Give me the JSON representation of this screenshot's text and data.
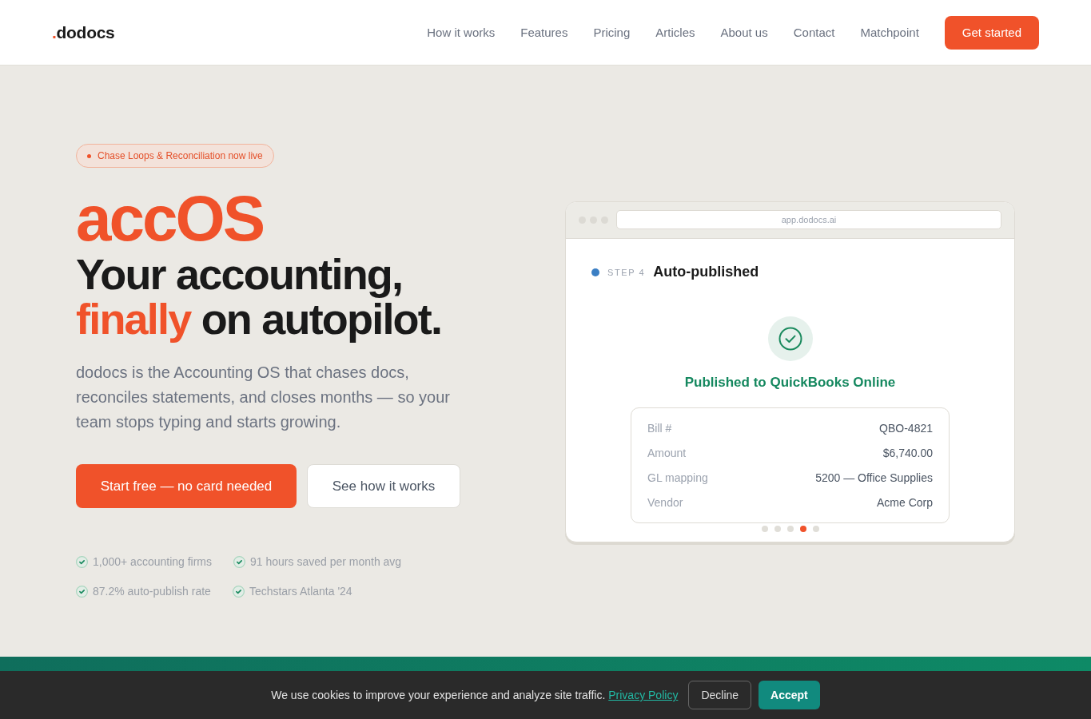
{
  "header": {
    "logo": {
      "dot": ".",
      "name": "dodocs"
    },
    "nav": [
      "How it works",
      "Features",
      "Pricing",
      "Articles",
      "About us",
      "Contact",
      "Matchpoint"
    ],
    "cta": "Get started"
  },
  "hero": {
    "badge": "Chase Loops & Reconciliation now live",
    "brand": "accOS",
    "headline": {
      "start": "Your accounting,",
      "accent": "finally",
      "end": "on autopilot."
    },
    "subtitle": "dodocs is the Accounting OS that chases docs, reconciles statements, and closes months — so your team stops typing and starts growing.",
    "buttons": [
      {
        "label": "Start free — no card needed",
        "kind": "primary"
      },
      {
        "label": "See how it works",
        "kind": "secondary"
      }
    ],
    "stats": [
      "1,000+ accounting firms",
      "91 hours saved per month avg",
      "87.2% auto-publish rate",
      "Techstars Atlanta '24"
    ]
  },
  "mockup": {
    "address": "app.dodocs.ai",
    "step_label": "STEP 4",
    "step_title": "Auto-published",
    "status": "Published to QuickBooks Online",
    "details": [
      {
        "label": "Bill #",
        "value": "QBO-4821"
      },
      {
        "label": "Amount",
        "value": "$6,740.00"
      },
      {
        "label": "GL mapping",
        "value": "5200 — Office Supplies"
      },
      {
        "label": "Vendor",
        "value": "Acme Corp"
      }
    ],
    "slides": [
      {
        "selected": false
      },
      {
        "selected": false
      },
      {
        "selected": false
      },
      {
        "selected": true
      },
      {
        "selected": false
      }
    ]
  },
  "cookie_banner": {
    "text": "We use cookies to improve your experience and analyze site traffic.",
    "link": "Privacy Policy",
    "buttons": [
      {
        "label": "Decline",
        "kind": "secondary"
      },
      {
        "label": "Accept",
        "kind": "primary"
      }
    ]
  }
}
